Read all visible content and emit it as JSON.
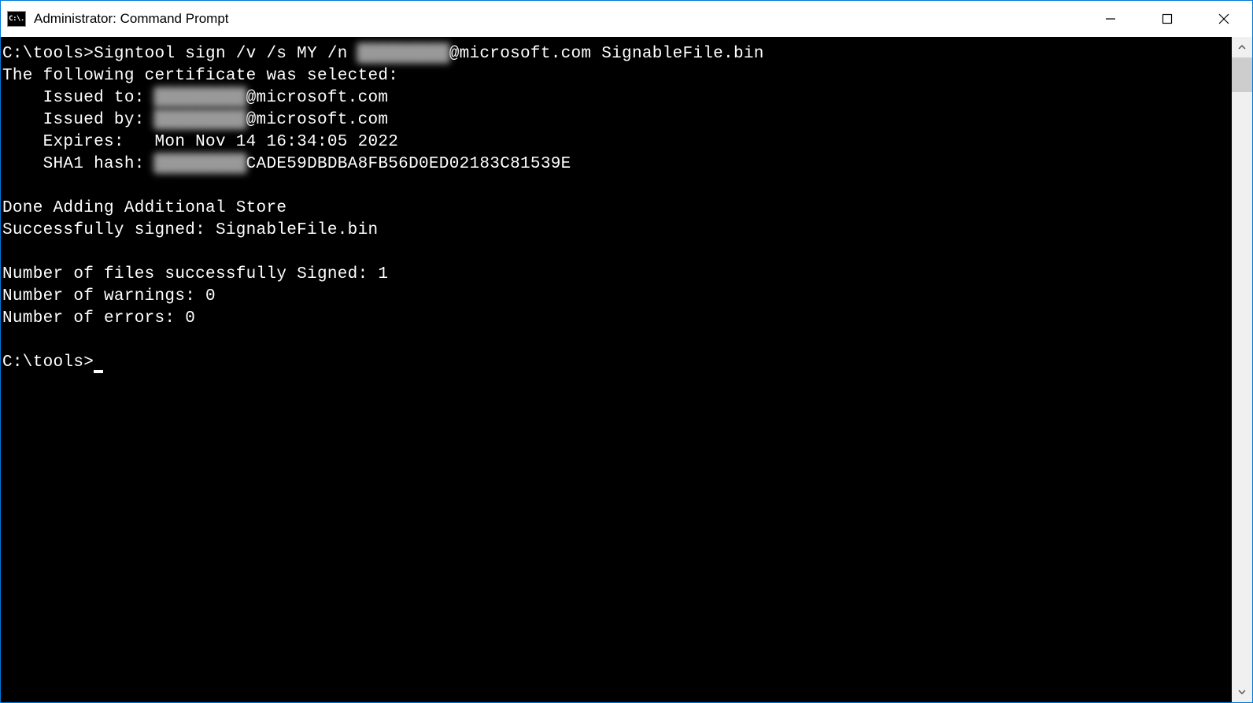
{
  "window": {
    "icon_label": "C:\\.",
    "title": "Administrator: Command Prompt"
  },
  "terminal": {
    "prompt1_prefix": "C:\\tools>",
    "command_part1": "Signtool sign /v /s MY /n ",
    "command_redacted": "█████████",
    "command_part2": "@microsoft.com SignableFile.bin",
    "line_cert_selected": "The following certificate was selected:",
    "issued_to_label": "    Issued to: ",
    "issued_to_redacted": "█████████",
    "issued_to_suffix": "@microsoft.com",
    "issued_by_label": "    Issued by: ",
    "issued_by_redacted": "█████████",
    "issued_by_suffix": "@microsoft.com",
    "expires_label": "    Expires:   ",
    "expires_value": "Mon Nov 14 16:34:05 2022",
    "sha1_label": "    SHA1 hash: ",
    "sha1_redacted": "█████████",
    "sha1_suffix": "CADE59DBDBA8FB56D0ED02183C81539E",
    "done_store": "Done Adding Additional Store",
    "signed_success": "Successfully signed: SignableFile.bin",
    "files_signed": "Number of files successfully Signed: 1",
    "warnings": "Number of warnings: 0",
    "errors": "Number of errors: 0",
    "prompt2": "C:\\tools>"
  }
}
